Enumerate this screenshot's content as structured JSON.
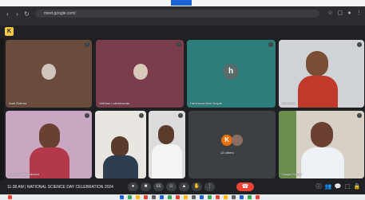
{
  "browser": {
    "url": "meet.google.com/",
    "nav_icons": [
      "back-icon",
      "forward-icon",
      "reload-icon"
    ],
    "right_icons": [
      "bookmark-icon",
      "extension-icon",
      "profile-icon",
      "menu-icon"
    ]
  },
  "meet": {
    "badge_label": "K",
    "tiles": [
      {
        "name": "Aarti Rathod",
        "avatar": ""
      },
      {
        "name": "Vaibhav Lakshmanan",
        "avatar": ""
      },
      {
        "name": "Harshavardhan Nayak",
        "avatar": "h"
      },
      {
        "name": "Poornima",
        "avatar": ""
      },
      {
        "name": "Ruchita Mahalakshmi",
        "avatar": ""
      },
      {
        "name": "",
        "avatar": ""
      },
      {
        "name": "",
        "avatar": ""
      },
      {
        "name": "12 others",
        "avatar": "K"
      },
      {
        "name": "Sanjay Kumar",
        "avatar": ""
      }
    ]
  },
  "controls": {
    "time_meeting": "11:38 AM  |  NATIONAL SCIENCE DAY CELEBRATION 2024",
    "end_call_icon": "end-call-icon"
  },
  "colors": {
    "accent_blue": "#1d63d6",
    "end_call": "#ea4335",
    "avatar_orange": "#e8710a",
    "avatar_teal": "#2e7d7d"
  }
}
